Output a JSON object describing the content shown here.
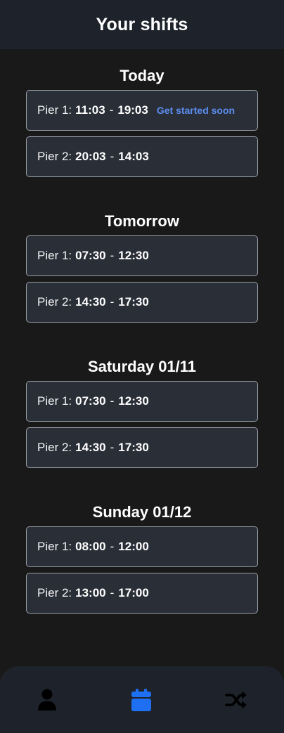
{
  "header": {
    "title": "Your shifts"
  },
  "days": [
    {
      "title": "Today",
      "shifts": [
        {
          "pier": "Pier 1:",
          "start": "11:03",
          "end": "19:03",
          "note": "Get started soon"
        },
        {
          "pier": "Pier 2:",
          "start": "20:03",
          "end": "14:03",
          "note": ""
        }
      ]
    },
    {
      "title": "Tomorrow",
      "shifts": [
        {
          "pier": "Pier 1:",
          "start": "07:30",
          "end": "12:30",
          "note": ""
        },
        {
          "pier": "Pier 2:",
          "start": "14:30",
          "end": "17:30",
          "note": ""
        }
      ]
    },
    {
      "title": "Saturday 01/11",
      "shifts": [
        {
          "pier": "Pier 1:",
          "start": "07:30",
          "end": "12:30",
          "note": ""
        },
        {
          "pier": "Pier 2:",
          "start": "14:30",
          "end": "17:30",
          "note": ""
        }
      ]
    },
    {
      "title": "Sunday 01/12",
      "shifts": [
        {
          "pier": "Pier 1:",
          "start": "08:00",
          "end": "12:00",
          "note": ""
        },
        {
          "pier": "Pier 2:",
          "start": "13:00",
          "end": "17:00",
          "note": ""
        }
      ]
    }
  ],
  "separator": "-",
  "nav": {
    "items": [
      {
        "icon": "person-icon",
        "active": false
      },
      {
        "icon": "calendar-icon",
        "active": true
      },
      {
        "icon": "shuffle-icon",
        "active": false
      }
    ],
    "active_color": "#1f6ff2",
    "inactive_color": "#000000"
  },
  "colors": {
    "header_bg": "#1e232b",
    "card_bg": "#2a2e37",
    "note": "#5b8def"
  }
}
